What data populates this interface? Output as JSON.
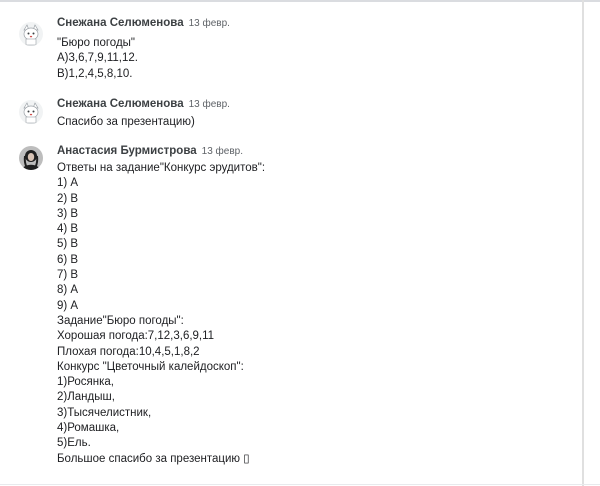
{
  "comments": [
    {
      "author": "Снежана Селюменова",
      "date": "13 февр.",
      "avatar_icon": "white-cat-cartoon-avatar",
      "lines": [
        "\"Бюро погоды\"",
        "А)3,6,7,9,11,12.",
        "В)1,2,4,5,8,10."
      ]
    },
    {
      "author": "Снежана Селюменова",
      "date": "13 февр.",
      "avatar_icon": "white-cat-cartoon-avatar",
      "lines": [
        "Спасибо за презентацию)"
      ]
    },
    {
      "author": "Анастасия Бурмистрова",
      "date": "13 февр.",
      "avatar_icon": "dark-haired-woman-photo-avatar",
      "lines": [
        "Ответы на задание\"Конкурс эрудитов\":",
        "1) А",
        "2) В",
        "3) В",
        "4) В",
        "5) В",
        "6) В",
        "7) В",
        "8) А",
        "9) А",
        "Задание\"Бюро погоды\":",
        "Хорошая погода:7,12,3,6,9,11",
        "Плохая погода:10,4,5,1,8,2",
        "Конкурс \"Цветочный калейдоскоп\":",
        "1)Росянка,",
        "2)Ландыш,",
        "3)Тысячелистник,",
        "4)Ромашка,",
        "5)Ель.",
        "Большое спасибо за презентацию ▯"
      ]
    }
  ]
}
